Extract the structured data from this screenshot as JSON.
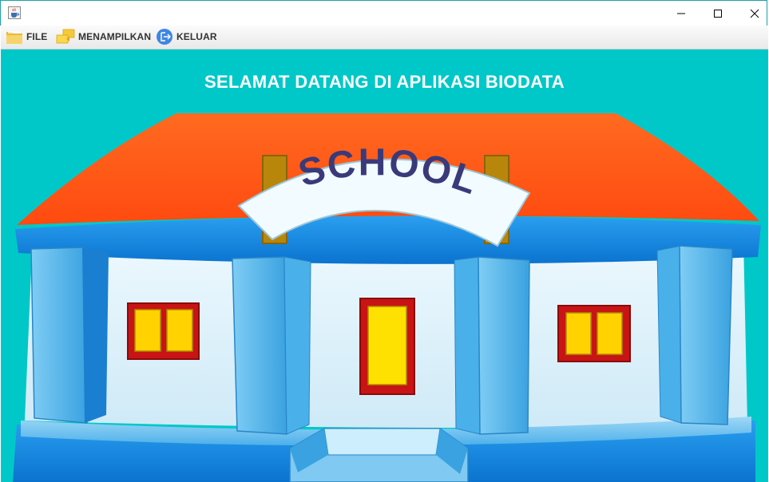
{
  "window": {
    "app_icon": "java-cup-icon",
    "controls": [
      "minimize-icon",
      "maximize-icon",
      "close-icon"
    ]
  },
  "menu": {
    "items": [
      {
        "label": "FILE",
        "icon": "folder-icon"
      },
      {
        "label": "MENAMPILKAN",
        "icon": "display-icon"
      },
      {
        "label": "KELUAR",
        "icon": "exit-icon"
      }
    ]
  },
  "main": {
    "heading": "SELAMAT DATANG DI APLIKASI BIODATA",
    "image": {
      "sign_text": "SCHOOL"
    }
  },
  "colors": {
    "background": "#00c8c8",
    "roof": "#ff5a1a",
    "wall": "#dff3fb",
    "pillar": "#5ab8ec",
    "window_frame": "#c81414",
    "window_glass": "#ffd200"
  }
}
